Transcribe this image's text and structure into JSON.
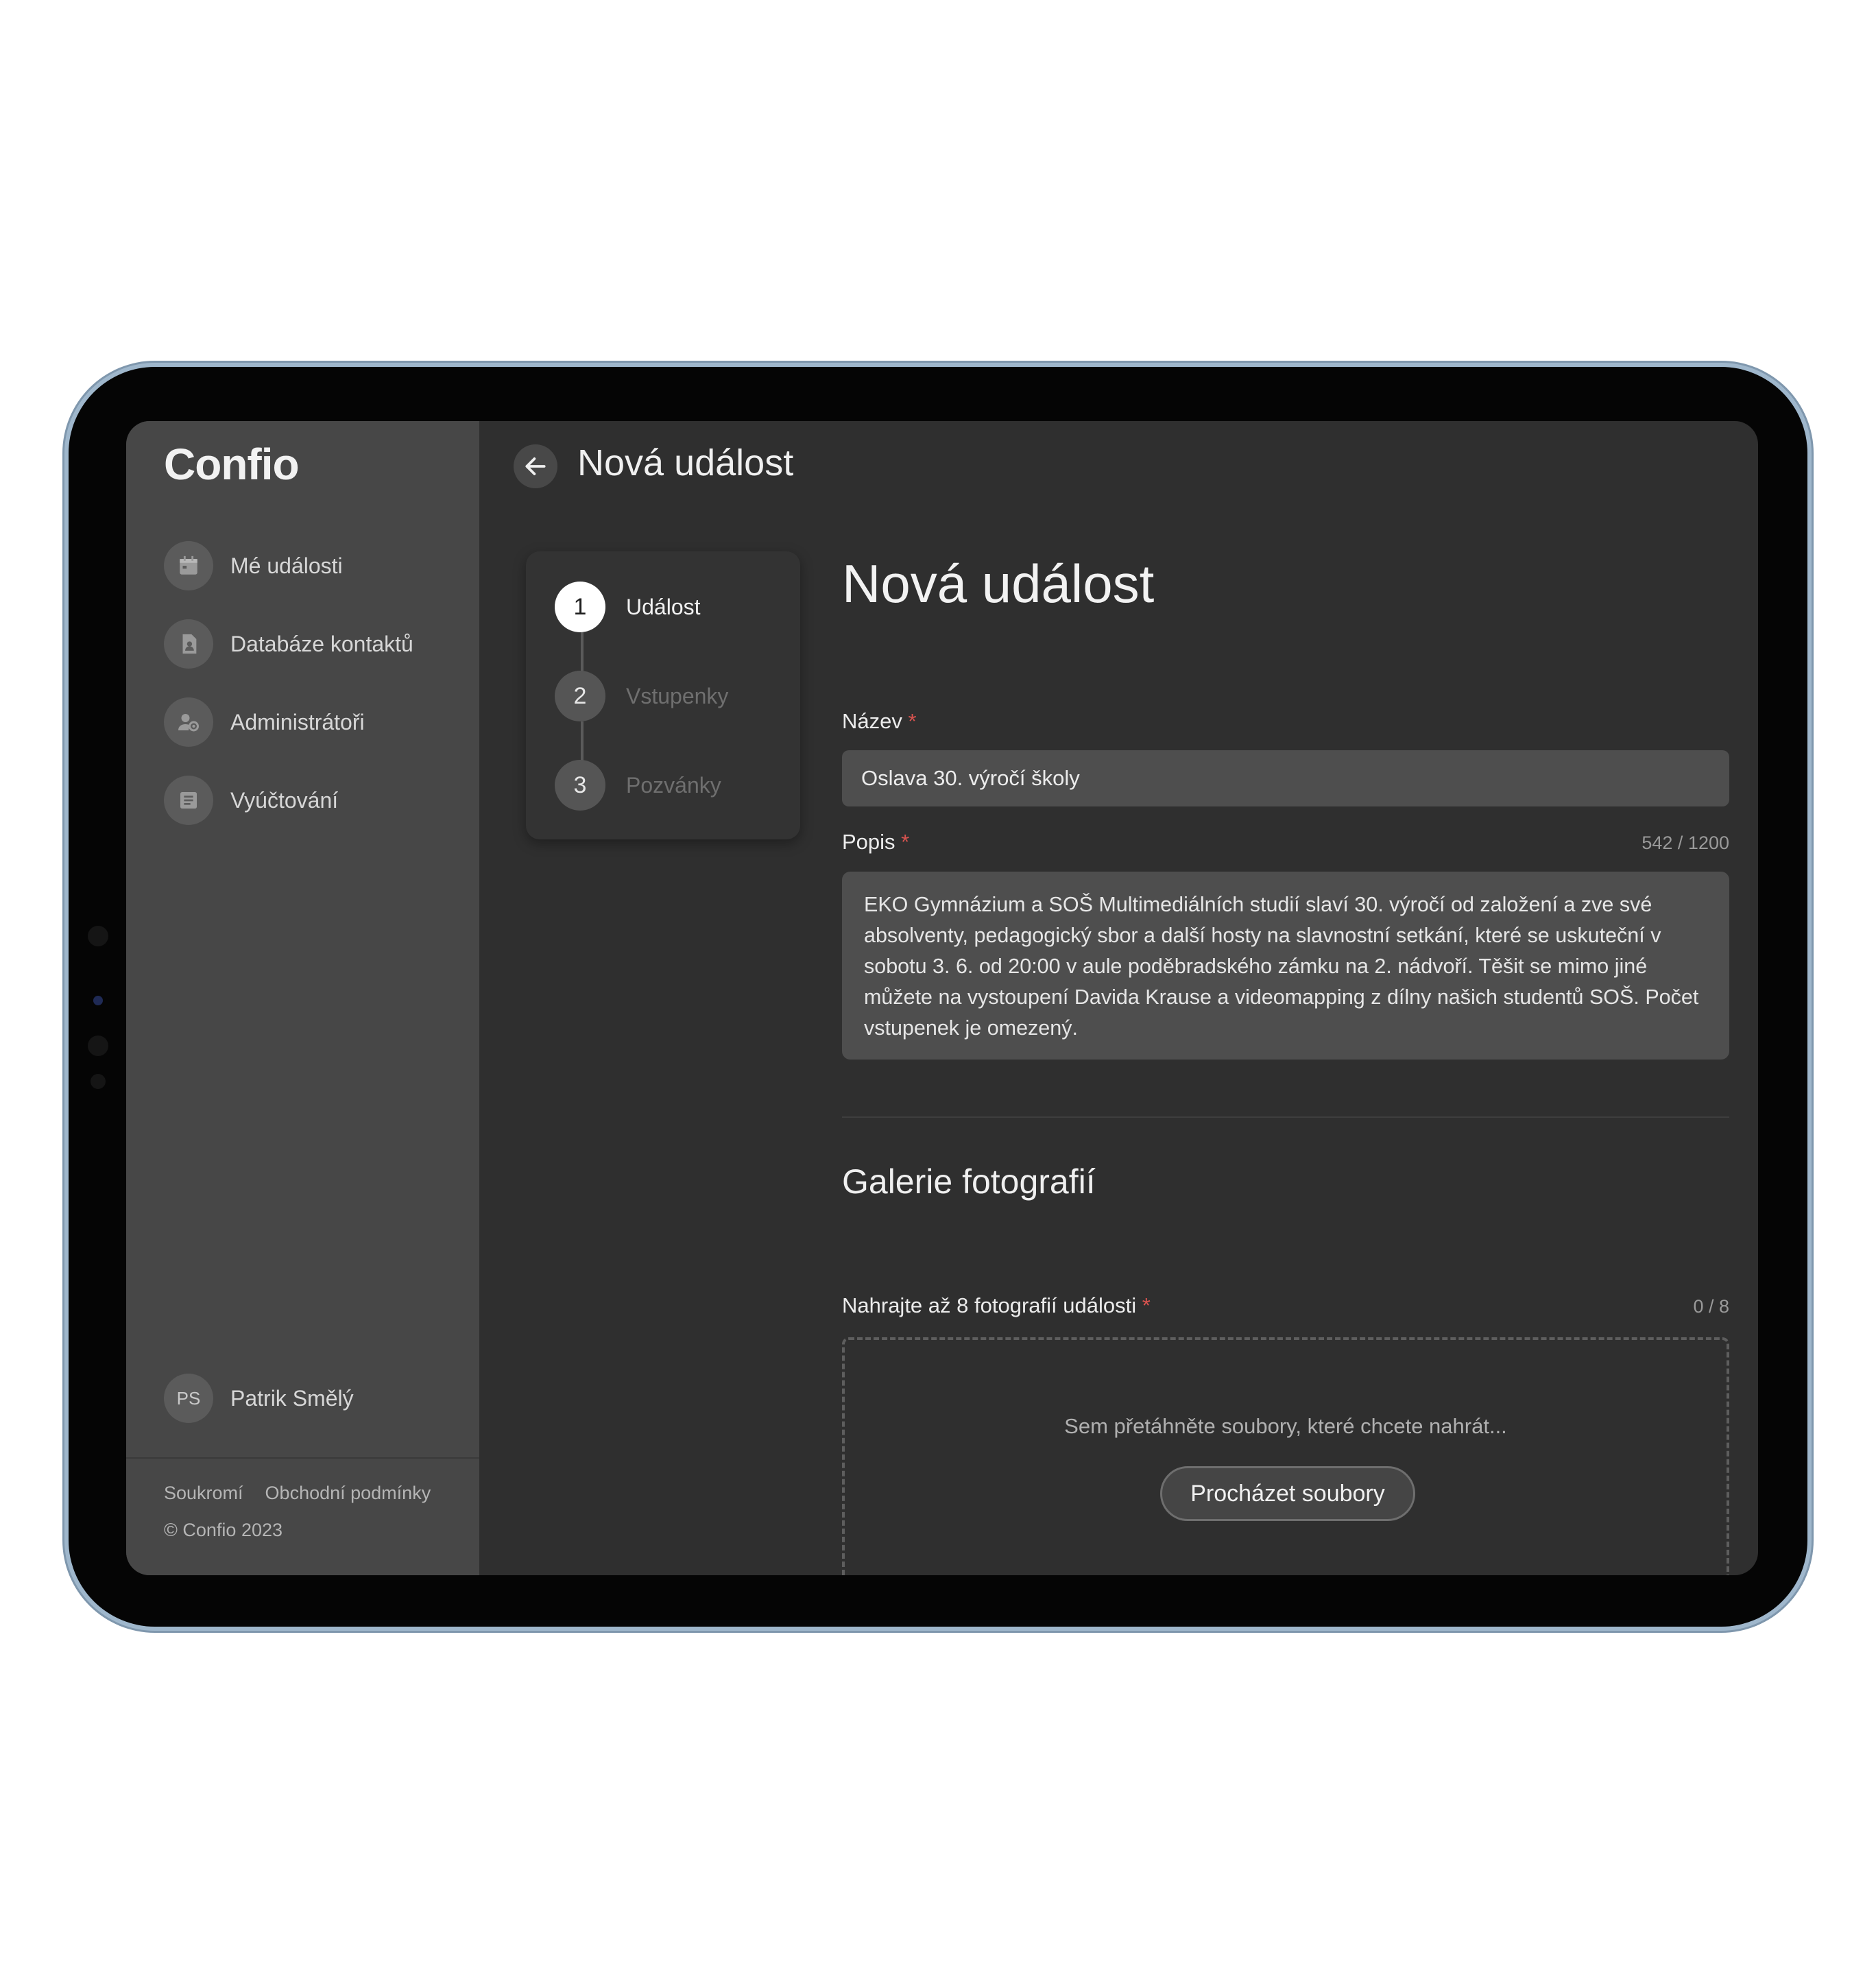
{
  "sidebar": {
    "logo": "Confio",
    "items": [
      {
        "label": "Mé události",
        "icon": "calendar-icon"
      },
      {
        "label": "Databáze kontaktů",
        "icon": "contact-card-icon"
      },
      {
        "label": "Administrátoři",
        "icon": "admin-user-icon"
      },
      {
        "label": "Vyúčtování",
        "icon": "invoice-icon"
      }
    ],
    "user": {
      "initials": "PS",
      "name": "Patrik Smělý"
    },
    "footer": {
      "privacy": "Soukromí",
      "terms": "Obchodní podmínky",
      "copyright": "© Confio 2023"
    }
  },
  "header": {
    "title": "Nová událost",
    "back_icon": "arrow-left-icon"
  },
  "stepper": {
    "steps": [
      {
        "number": "1",
        "label": "Událost",
        "active": true
      },
      {
        "number": "2",
        "label": "Vstupenky",
        "active": false
      },
      {
        "number": "3",
        "label": "Pozvánky",
        "active": false
      }
    ]
  },
  "form": {
    "title": "Nová událost",
    "name_label": "Název",
    "name_value": "Oslava 30. výročí školy",
    "required_mark": "*",
    "description_label": "Popis",
    "description_counter": "542 / 1200",
    "description_value": "EKO Gymnázium a SOŠ Multimediálních studií  slaví 30. výročí od založení a zve své absolventy, pedagogický sbor a další hosty na slavnostní setkání, které se uskuteční v sobotu 3. 6. od 20:00 v aule poděbradského zámku na 2. nádvoří. Těšit se mimo jiné můžete na vystoupení Davida Krause a videomapping z dílny našich studentů SOŠ. Počet vstupenek je omezený."
  },
  "gallery": {
    "title": "Galerie fotografií",
    "upload_label": "Nahrajte až 8 fotografií události",
    "upload_counter": "0 / 8",
    "drop_text": "Sem přetáhněte soubory, které chcete nahrát...",
    "browse_label": "Procházet soubory"
  },
  "colors": {
    "sidebar_bg": "#474747",
    "main_bg": "#2f2f2f",
    "field_bg": "#4e4e4e",
    "required": "#d9534f",
    "frame_accent": "#9fb7cc"
  }
}
